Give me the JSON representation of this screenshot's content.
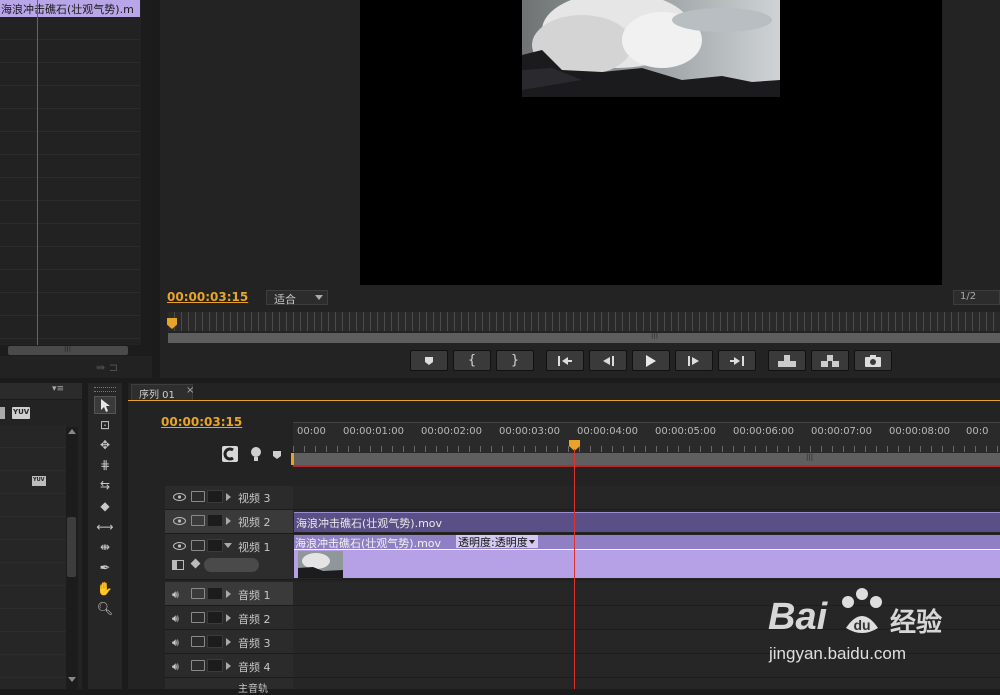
{
  "source_panel": {
    "clip_name": "海浪冲击礁石(壮观气势).m",
    "scroll_grip": "|||"
  },
  "program_monitor": {
    "timecode": "00:00:03:15",
    "fit_label": "适合",
    "resolution": "1/2",
    "scrub_grip": "|||"
  },
  "timeline": {
    "tab_name": "序列 01",
    "tab_close": "×",
    "timecode": "00:00:03:15",
    "ruler_ticks": [
      "00:00",
      "00:00:01:00",
      "00:00:02:00",
      "00:00:03:00",
      "00:00:04:00",
      "00:00:05:00",
      "00:00:06:00",
      "00:00:07:00",
      "00:00:08:00",
      "00:0"
    ],
    "scroll_grip": "|||",
    "tracks": {
      "video3": "视频 3",
      "video2": "视频 2",
      "video1": "视频 1",
      "audio1": "音频 1",
      "audio2": "音频 2",
      "audio3": "音频 3",
      "audio4": "音频 4",
      "master": "主音轨"
    },
    "clips": {
      "video2_clip": "海浪冲击礁石(壮观气势).mov",
      "video1_clip": "海浪冲击礁石(壮观气势).mov",
      "opacity_label": "透明度:透明度"
    }
  },
  "project_panel": {
    "badge": "YUV",
    "badge_small": "YUV"
  },
  "watermark": {
    "brand": "Bai",
    "brand_cn": "经验",
    "url": "jingyan.baidu.com"
  },
  "colors": {
    "accent_timecode": "#e8a42a",
    "playhead": "#e0312e",
    "clip_purple": "#b6a1e6",
    "clip_dark": "#5a4f86"
  }
}
